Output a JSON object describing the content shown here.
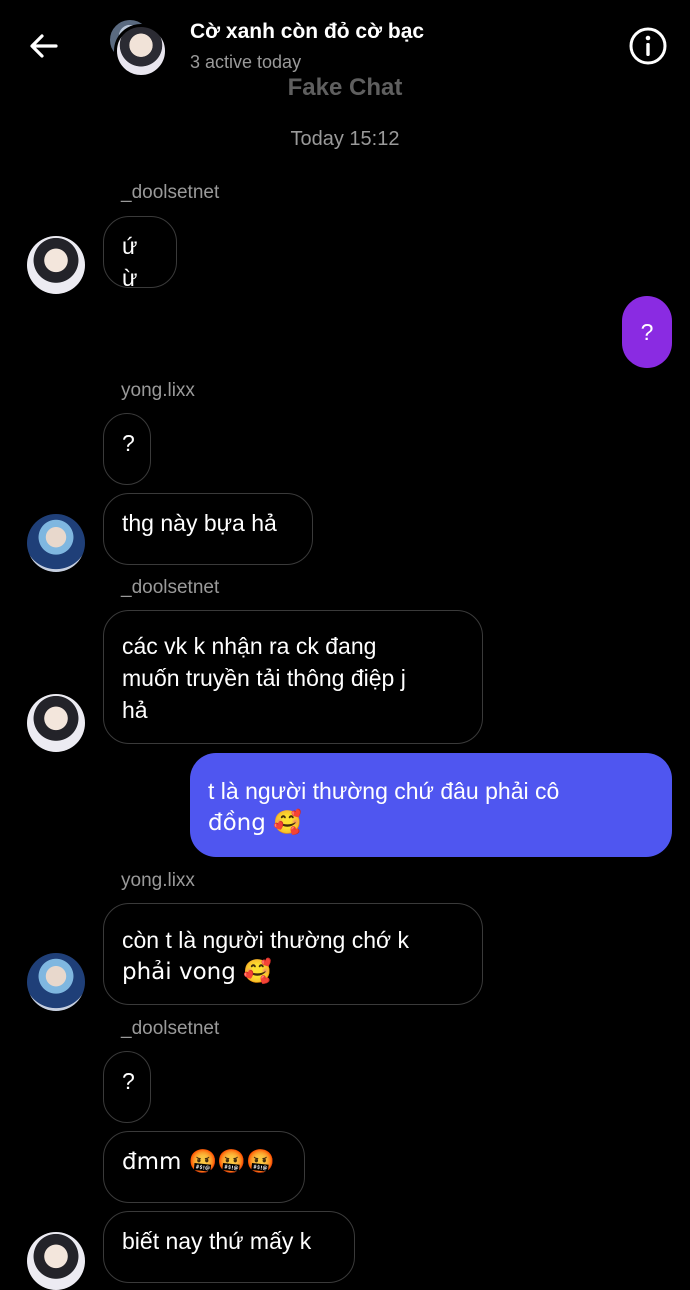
{
  "header": {
    "title": "Cờ xanh còn đỏ cờ bạc",
    "subtitle": "3 active today",
    "watermark": "Fake Chat"
  },
  "timestamp": "Today 15:12",
  "messages": [
    {
      "sender": "_doolsetnet",
      "text": "ứ ừ"
    },
    {
      "text": "?"
    },
    {
      "sender": "yong.lixx",
      "text": "?"
    },
    {
      "text": "thg này bựa hả"
    },
    {
      "sender": "_doolsetnet",
      "line1": "các vk k nhận ra ck đang",
      "line2": "muốn truyền tải thông điệp j",
      "line3": "hả"
    },
    {
      "line1": "t là người thường chứ đâu phải cô",
      "line2": "đồng 🥰"
    },
    {
      "sender": "yong.lixx",
      "line1": "còn t là người thường chớ k",
      "line2": "phải vong 🥰"
    },
    {
      "sender": "_doolsetnet",
      "text": "?"
    },
    {
      "text": "đmm 🤬🤬🤬"
    },
    {
      "text": "biết nay thứ mấy k"
    }
  ],
  "colors": {
    "outgoing_blue": "#4f56f0",
    "outgoing_violet": "#8a2be2",
    "background": "#000000"
  },
  "icons": [
    "back-arrow-icon",
    "info-icon"
  ]
}
